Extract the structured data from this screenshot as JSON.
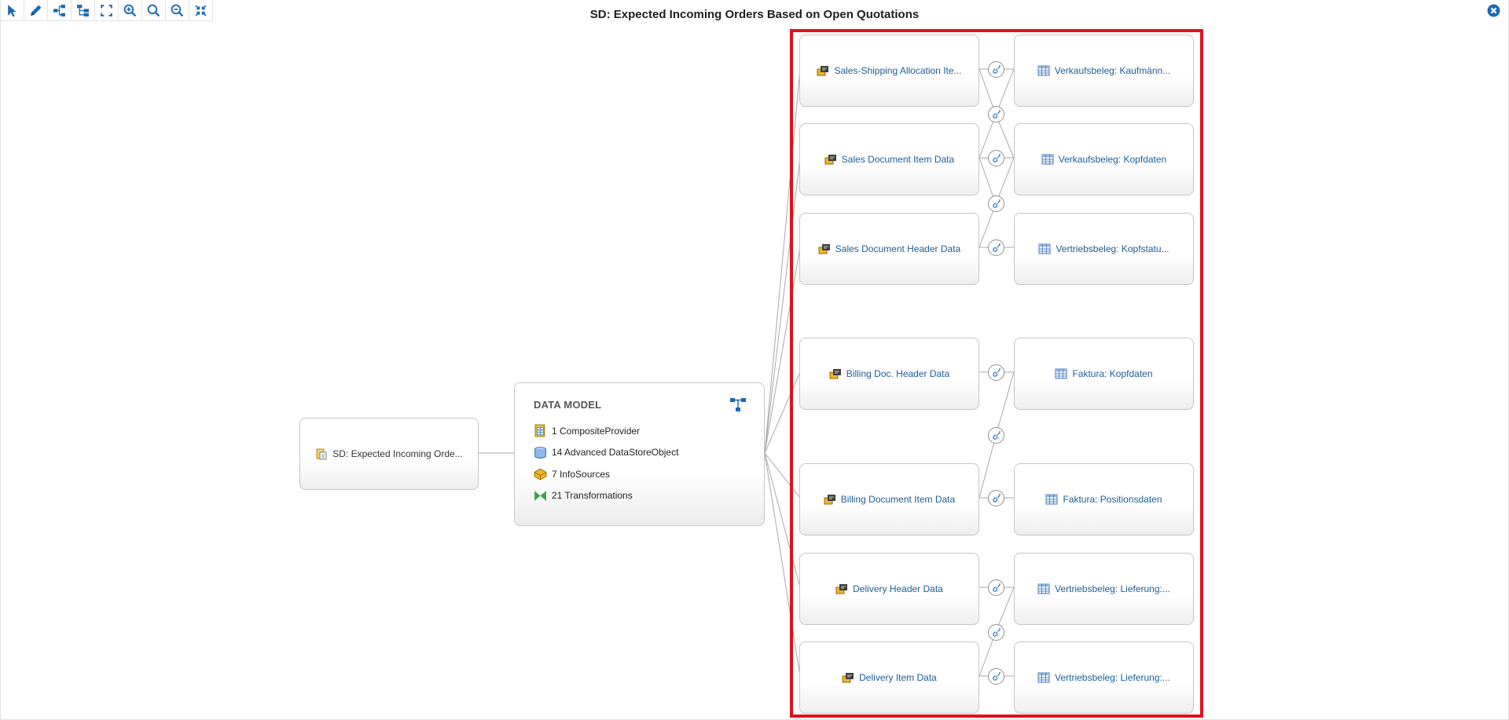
{
  "title": "SD: Expected Incoming Orders Based on Open Quotations",
  "toolbar": {
    "buttons": [
      {
        "name": "select-tool-button",
        "icon": "pointer-icon"
      },
      {
        "name": "edit-tool-button",
        "icon": "pencil-icon"
      },
      {
        "name": "horizontal-layout-button",
        "icon": "tree-horizontal-icon"
      },
      {
        "name": "vertical-layout-button",
        "icon": "tree-vertical-icon"
      },
      {
        "name": "fit-screen-button",
        "icon": "fit-screen-icon"
      },
      {
        "name": "zoom-in-button",
        "icon": "zoom-in-icon"
      },
      {
        "name": "zoom-reset-button",
        "icon": "search-icon"
      },
      {
        "name": "zoom-out-button",
        "icon": "zoom-out-icon"
      },
      {
        "name": "collapse-button",
        "icon": "collapse-icon"
      }
    ]
  },
  "source_node": {
    "label": "SD: Expected Incoming Orde...",
    "icon": "query-icon"
  },
  "data_model": {
    "title": "DATA MODEL",
    "items": [
      {
        "label": "1 CompositeProvider",
        "icon": "composite-provider-icon"
      },
      {
        "label": "14 Advanced DataStoreObject",
        "icon": "datastore-icon"
      },
      {
        "label": "7 InfoSources",
        "icon": "infosource-icon"
      },
      {
        "label": "21 Transformations",
        "icon": "transformation-icon"
      }
    ]
  },
  "datasources": [
    {
      "label": "Sales-Shipping Allocation Ite...",
      "icon": "datasource-icon"
    },
    {
      "label": "Sales Document Item Data",
      "icon": "datasource-icon"
    },
    {
      "label": "Sales Document Header Data",
      "icon": "datasource-icon"
    },
    {
      "label": "Billing Doc. Header Data",
      "icon": "datasource-icon"
    },
    {
      "label": "Billing Document Item Data",
      "icon": "datasource-icon"
    },
    {
      "label": "Delivery Header Data",
      "icon": "datasource-icon"
    },
    {
      "label": "Delivery Item Data",
      "icon": "datasource-icon"
    }
  ],
  "tables": [
    {
      "label": "Verkaufsbeleg: Kaufmänn...",
      "icon": "table-icon"
    },
    {
      "label": "Verkaufsbeleg: Kopfdaten",
      "icon": "table-icon"
    },
    {
      "label": "Vertriebsbeleg: Kopfstatu...",
      "icon": "table-icon"
    },
    {
      "label": "Faktura: Kopfdaten",
      "icon": "table-icon"
    },
    {
      "label": "Faktura: Positionsdaten",
      "icon": "table-icon"
    },
    {
      "label": "Vertriebsbeleg: Lieferung:...",
      "icon": "table-icon"
    },
    {
      "label": "Vertriebsbeleg: Lieferung:...",
      "icon": "table-icon"
    }
  ],
  "colors": {
    "highlight": "#e0121b",
    "link_text": "#1a5e9a",
    "toolbar_icon": "#1b6ab4",
    "connector": "#a8a8a8"
  }
}
